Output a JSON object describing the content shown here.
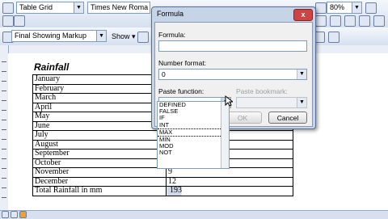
{
  "toolbar1": {
    "style_value": "Table Grid",
    "font_value": "Times New Roma",
    "zoom_value": "80%"
  },
  "toolbar2": {
    "markup_value": "Final Showing Markup",
    "show_label": "Show ▾"
  },
  "document": {
    "title": "Rainfall",
    "rows": [
      {
        "month": "January",
        "value": ""
      },
      {
        "month": "February",
        "value": ""
      },
      {
        "month": "March",
        "value": ""
      },
      {
        "month": "April",
        "value": ""
      },
      {
        "month": "May",
        "value": ""
      },
      {
        "month": "June",
        "value": ""
      },
      {
        "month": "July",
        "value": ""
      },
      {
        "month": "August",
        "value": ""
      },
      {
        "month": "September",
        "value": ""
      },
      {
        "month": "October",
        "value": ""
      },
      {
        "month": "November",
        "value": "9"
      },
      {
        "month": "December",
        "value": "12"
      },
      {
        "month": "Total Rainfall in mm",
        "value": "193"
      }
    ]
  },
  "dialog": {
    "title": "Formula",
    "close_label": "x",
    "formula_label": "Formula:",
    "formula_value": "",
    "number_format_label": "Number format:",
    "number_format_value": "0",
    "paste_function_label": "Paste function:",
    "paste_bookmark_label": "Paste bookmark:",
    "ok_label": "OK",
    "cancel_label": "Cancel"
  },
  "function_list": [
    "DEFINED",
    "FALSE",
    "IF",
    "INT",
    "MAX",
    "MIN",
    "MOD",
    "NOT"
  ],
  "selected_function": "MAX"
}
